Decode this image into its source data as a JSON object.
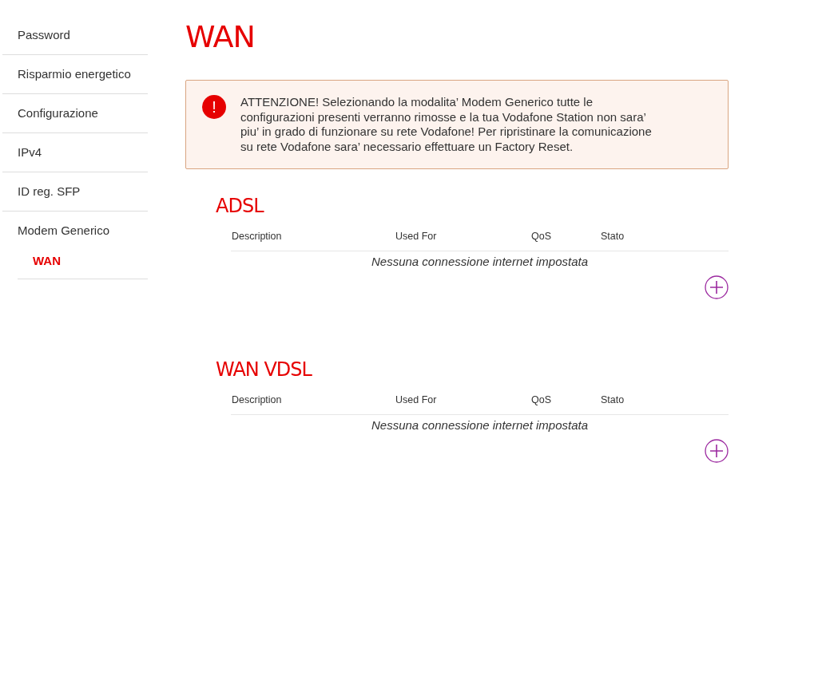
{
  "sidebar": {
    "items": [
      {
        "label": "Password",
        "selected": false
      },
      {
        "label": "Risparmio energetico",
        "selected": false
      },
      {
        "label": "Configurazione",
        "selected": false
      },
      {
        "label": "IPv4",
        "selected": false
      },
      {
        "label": "ID reg. SFP",
        "selected": false
      },
      {
        "label": "Modem Generico",
        "selected": false,
        "children": [
          {
            "label": "WAN",
            "selected": true
          }
        ]
      }
    ]
  },
  "title": "WAN",
  "alert": {
    "icon": "!",
    "text": "ATTENZIONE! Selezionando la modalita’ Modem Generico tutte le configurazioni presenti verranno rimosse e la tua Vodafone Station non sara’ piu’ in grado di funzionare su rete Vodafone! Per ripristinare la comunicazione su rete Vodafone sara’ necessario effettuare un Factory Reset."
  },
  "sections": [
    {
      "title": "ADSL",
      "columns": [
        "Description",
        "Used For",
        "QoS",
        "Stato"
      ],
      "empty_message": "Nessuna connessione internet impostata"
    },
    {
      "title": "WAN VDSL",
      "columns": [
        "Description",
        "Used For",
        "QoS",
        "Stato"
      ],
      "empty_message": "Nessuna connessione internet impostata"
    }
  ]
}
